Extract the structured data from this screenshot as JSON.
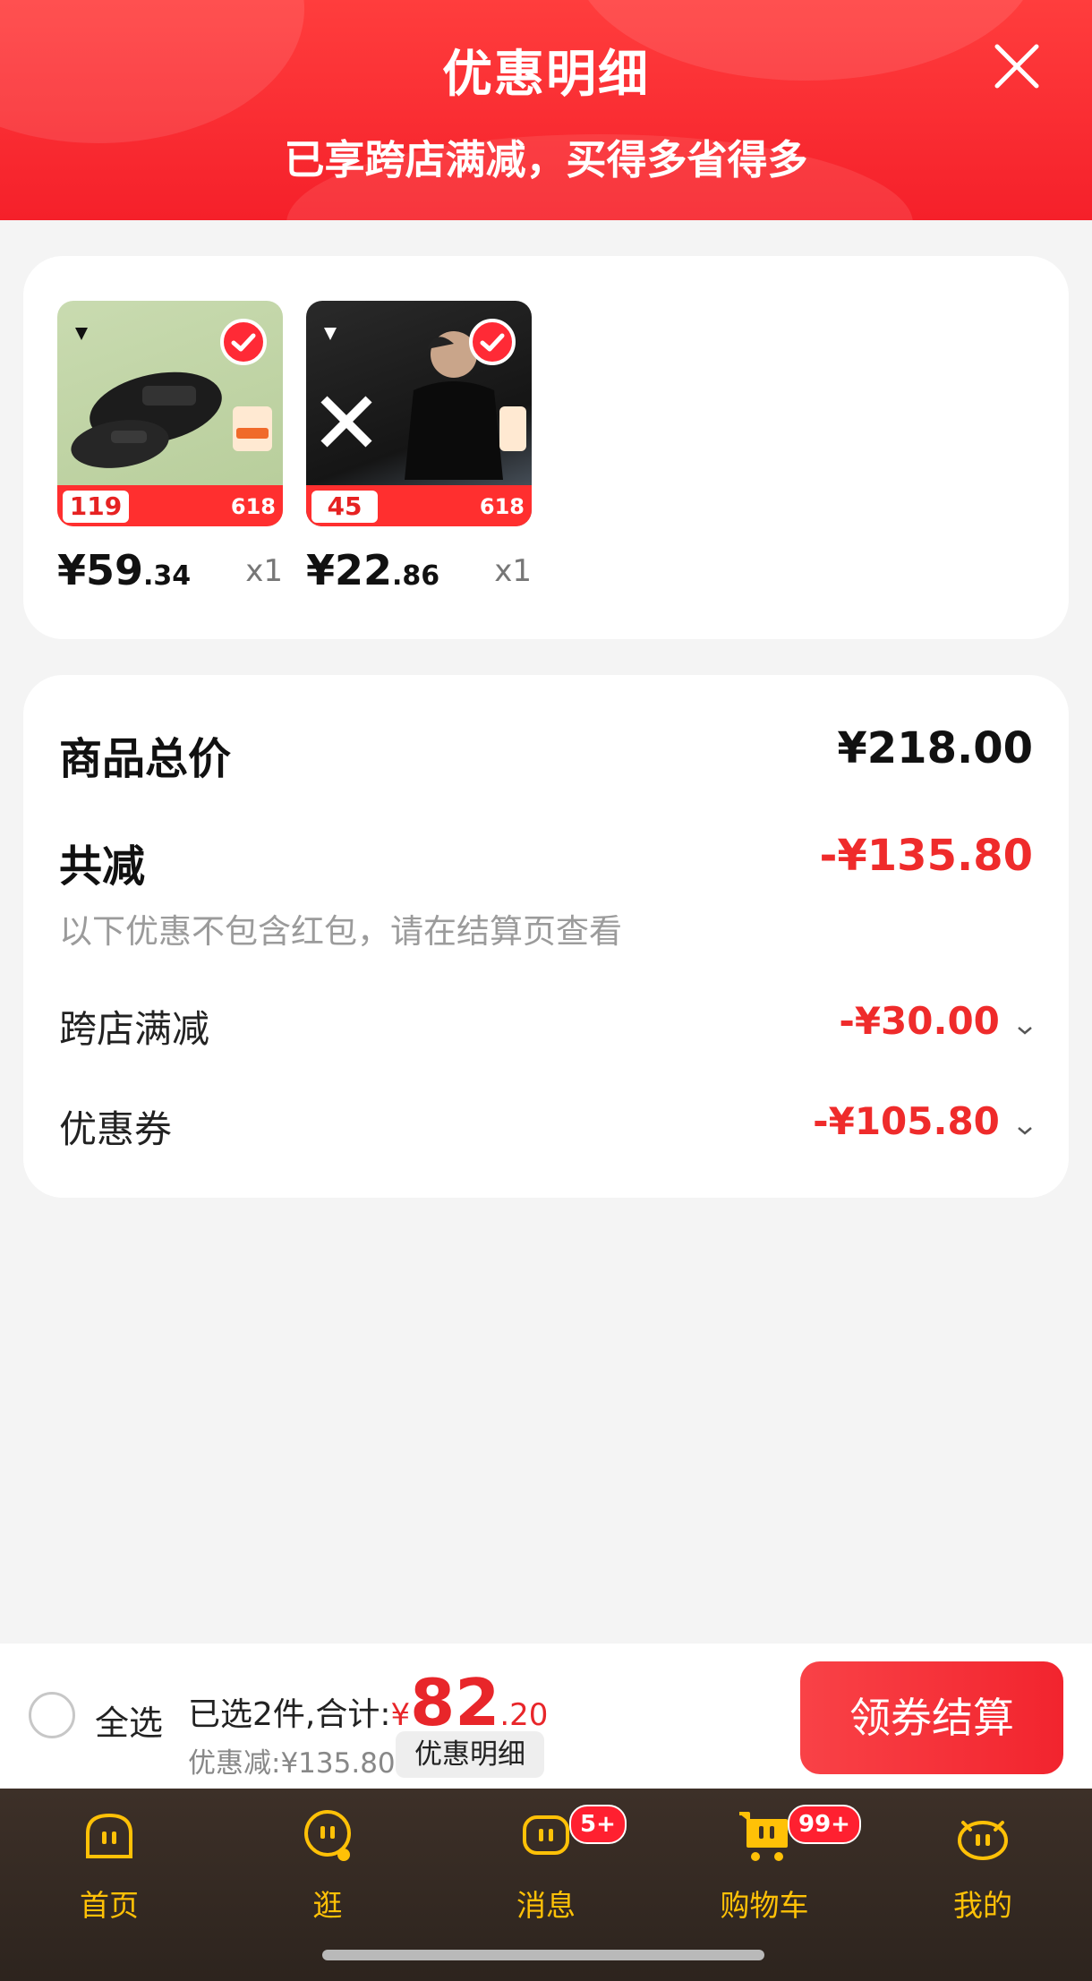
{
  "header": {
    "title": "优惠明细",
    "subtitle": "已享跨店满减，买得多省得多"
  },
  "products": [
    {
      "price_int": "¥59",
      "price_dec": ".34",
      "qty": "x1",
      "thumb_price": "119",
      "thumb_tag": "618"
    },
    {
      "price_int": "¥22",
      "price_dec": ".86",
      "qty": "x1",
      "thumb_price": "45",
      "thumb_tag": "618"
    }
  ],
  "summary": {
    "total_label": "商品总价",
    "total_value": "¥218.00",
    "discount_label": "共减",
    "discount_value": "-¥135.80",
    "note": "以下优惠不包含红包，请在结算页查看",
    "cross_store_label": "跨店满减",
    "cross_store_value": "-¥30.00",
    "coupon_label": "优惠券",
    "coupon_value": "-¥105.80"
  },
  "bottom_bar": {
    "select_all": "全选",
    "selected_text": "已选2件,合计:",
    "total_currency": "¥",
    "total_int": "82",
    "total_dec": ".20",
    "saved_text": "优惠减:¥135.80",
    "detail_button": "优惠明细",
    "checkout_button": "领券结算"
  },
  "tabbar": {
    "items": [
      {
        "label": "首页",
        "icon": "home-icon"
      },
      {
        "label": "逛",
        "icon": "browse-icon"
      },
      {
        "label": "消息",
        "icon": "message-icon",
        "badge": "5+"
      },
      {
        "label": "购物车",
        "icon": "cart-icon",
        "badge": "99+"
      },
      {
        "label": "我的",
        "icon": "profile-icon"
      }
    ]
  },
  "colors": {
    "header_red": "#f5202a",
    "price_red": "#ef2b2b",
    "tab_gold": "#ffc107",
    "tabbar_bg": "#2d241e"
  }
}
